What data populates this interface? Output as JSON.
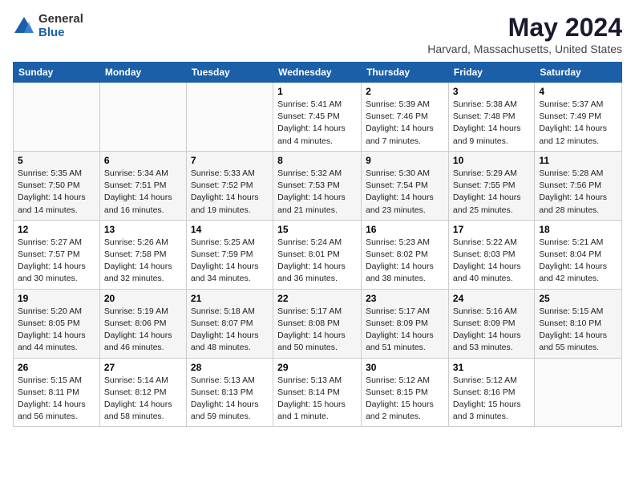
{
  "logo": {
    "general": "General",
    "blue": "Blue"
  },
  "title": "May 2024",
  "subtitle": "Harvard, Massachusetts, United States",
  "headers": [
    "Sunday",
    "Monday",
    "Tuesday",
    "Wednesday",
    "Thursday",
    "Friday",
    "Saturday"
  ],
  "weeks": [
    [
      {
        "day": "",
        "info": ""
      },
      {
        "day": "",
        "info": ""
      },
      {
        "day": "",
        "info": ""
      },
      {
        "day": "1",
        "info": "Sunrise: 5:41 AM\nSunset: 7:45 PM\nDaylight: 14 hours\nand 4 minutes."
      },
      {
        "day": "2",
        "info": "Sunrise: 5:39 AM\nSunset: 7:46 PM\nDaylight: 14 hours\nand 7 minutes."
      },
      {
        "day": "3",
        "info": "Sunrise: 5:38 AM\nSunset: 7:48 PM\nDaylight: 14 hours\nand 9 minutes."
      },
      {
        "day": "4",
        "info": "Sunrise: 5:37 AM\nSunset: 7:49 PM\nDaylight: 14 hours\nand 12 minutes."
      }
    ],
    [
      {
        "day": "5",
        "info": "Sunrise: 5:35 AM\nSunset: 7:50 PM\nDaylight: 14 hours\nand 14 minutes."
      },
      {
        "day": "6",
        "info": "Sunrise: 5:34 AM\nSunset: 7:51 PM\nDaylight: 14 hours\nand 16 minutes."
      },
      {
        "day": "7",
        "info": "Sunrise: 5:33 AM\nSunset: 7:52 PM\nDaylight: 14 hours\nand 19 minutes."
      },
      {
        "day": "8",
        "info": "Sunrise: 5:32 AM\nSunset: 7:53 PM\nDaylight: 14 hours\nand 21 minutes."
      },
      {
        "day": "9",
        "info": "Sunrise: 5:30 AM\nSunset: 7:54 PM\nDaylight: 14 hours\nand 23 minutes."
      },
      {
        "day": "10",
        "info": "Sunrise: 5:29 AM\nSunset: 7:55 PM\nDaylight: 14 hours\nand 25 minutes."
      },
      {
        "day": "11",
        "info": "Sunrise: 5:28 AM\nSunset: 7:56 PM\nDaylight: 14 hours\nand 28 minutes."
      }
    ],
    [
      {
        "day": "12",
        "info": "Sunrise: 5:27 AM\nSunset: 7:57 PM\nDaylight: 14 hours\nand 30 minutes."
      },
      {
        "day": "13",
        "info": "Sunrise: 5:26 AM\nSunset: 7:58 PM\nDaylight: 14 hours\nand 32 minutes."
      },
      {
        "day": "14",
        "info": "Sunrise: 5:25 AM\nSunset: 7:59 PM\nDaylight: 14 hours\nand 34 minutes."
      },
      {
        "day": "15",
        "info": "Sunrise: 5:24 AM\nSunset: 8:01 PM\nDaylight: 14 hours\nand 36 minutes."
      },
      {
        "day": "16",
        "info": "Sunrise: 5:23 AM\nSunset: 8:02 PM\nDaylight: 14 hours\nand 38 minutes."
      },
      {
        "day": "17",
        "info": "Sunrise: 5:22 AM\nSunset: 8:03 PM\nDaylight: 14 hours\nand 40 minutes."
      },
      {
        "day": "18",
        "info": "Sunrise: 5:21 AM\nSunset: 8:04 PM\nDaylight: 14 hours\nand 42 minutes."
      }
    ],
    [
      {
        "day": "19",
        "info": "Sunrise: 5:20 AM\nSunset: 8:05 PM\nDaylight: 14 hours\nand 44 minutes."
      },
      {
        "day": "20",
        "info": "Sunrise: 5:19 AM\nSunset: 8:06 PM\nDaylight: 14 hours\nand 46 minutes."
      },
      {
        "day": "21",
        "info": "Sunrise: 5:18 AM\nSunset: 8:07 PM\nDaylight: 14 hours\nand 48 minutes."
      },
      {
        "day": "22",
        "info": "Sunrise: 5:17 AM\nSunset: 8:08 PM\nDaylight: 14 hours\nand 50 minutes."
      },
      {
        "day": "23",
        "info": "Sunrise: 5:17 AM\nSunset: 8:09 PM\nDaylight: 14 hours\nand 51 minutes."
      },
      {
        "day": "24",
        "info": "Sunrise: 5:16 AM\nSunset: 8:09 PM\nDaylight: 14 hours\nand 53 minutes."
      },
      {
        "day": "25",
        "info": "Sunrise: 5:15 AM\nSunset: 8:10 PM\nDaylight: 14 hours\nand 55 minutes."
      }
    ],
    [
      {
        "day": "26",
        "info": "Sunrise: 5:15 AM\nSunset: 8:11 PM\nDaylight: 14 hours\nand 56 minutes."
      },
      {
        "day": "27",
        "info": "Sunrise: 5:14 AM\nSunset: 8:12 PM\nDaylight: 14 hours\nand 58 minutes."
      },
      {
        "day": "28",
        "info": "Sunrise: 5:13 AM\nSunset: 8:13 PM\nDaylight: 14 hours\nand 59 minutes."
      },
      {
        "day": "29",
        "info": "Sunrise: 5:13 AM\nSunset: 8:14 PM\nDaylight: 15 hours\nand 1 minute."
      },
      {
        "day": "30",
        "info": "Sunrise: 5:12 AM\nSunset: 8:15 PM\nDaylight: 15 hours\nand 2 minutes."
      },
      {
        "day": "31",
        "info": "Sunrise: 5:12 AM\nSunset: 8:16 PM\nDaylight: 15 hours\nand 3 minutes."
      },
      {
        "day": "",
        "info": ""
      }
    ]
  ]
}
